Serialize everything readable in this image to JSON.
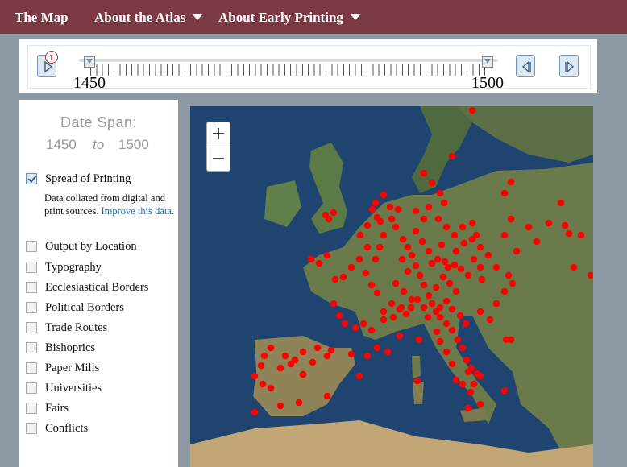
{
  "nav": {
    "items": [
      {
        "label": "The Map",
        "dropdown": false
      },
      {
        "label": "About the Atlas",
        "dropdown": true
      },
      {
        "label": "About Early Printing",
        "dropdown": true
      }
    ]
  },
  "timeline": {
    "play_badge": "1",
    "start_year": "1450",
    "end_year": "1500",
    "icons": [
      "play-icon",
      "step-back-icon",
      "step-forward-icon"
    ]
  },
  "panel": {
    "date_span_label": "Date Span:",
    "date_from": "1450",
    "date_to_word": "to",
    "date_to": "1500",
    "note_text": "Data collated from digital and print sources. ",
    "note_link": "Improve this data",
    "note_end": ".",
    "layers": [
      {
        "label": "Spread of Printing",
        "checked": true
      },
      {
        "label": "Output by Location",
        "checked": false
      },
      {
        "label": "Typography",
        "checked": false
      },
      {
        "label": "Ecclesiastical Borders",
        "checked": false
      },
      {
        "label": "Political Borders",
        "checked": false
      },
      {
        "label": "Trade Routes",
        "checked": false
      },
      {
        "label": "Bishoprics",
        "checked": false
      },
      {
        "label": "Paper Mills",
        "checked": false
      },
      {
        "label": "Universities",
        "checked": false
      },
      {
        "label": "Fairs",
        "checked": false
      },
      {
        "label": "Conflicts",
        "checked": false
      }
    ]
  },
  "map": {
    "zoom_in": "+",
    "zoom_out": "−",
    "marker_color": "#ff0000"
  },
  "colors": {
    "nav_bg": "#7b3a43",
    "link": "#1f6db0"
  }
}
